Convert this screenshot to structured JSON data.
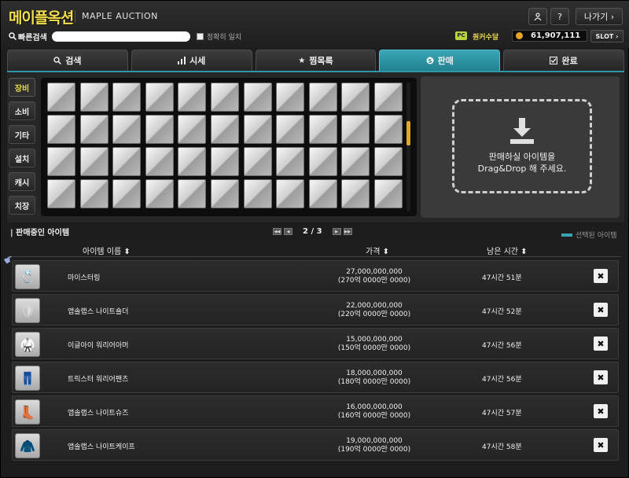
{
  "header": {
    "logo": "메이플옥션",
    "subtitle": "MAPLE AUCTION",
    "profile_icon": "person-icon",
    "help_label": "?",
    "exit_label": "나가기 ›"
  },
  "search": {
    "label": "빠른검색",
    "value": "",
    "exact_label": "정확히 일치"
  },
  "wallet": {
    "pc_badge": "PC",
    "currency_label": "퀀커수달",
    "meso": "61,907,111",
    "slot_label": "SLOT ›"
  },
  "tabs": [
    {
      "label": "검색",
      "icon": "search-icon"
    },
    {
      "label": "시세",
      "icon": "bar-chart-icon"
    },
    {
      "label": "찜목록",
      "icon": "star-icon"
    },
    {
      "label": "판매",
      "icon": "coin-icon"
    },
    {
      "label": "완료",
      "icon": "check-box-icon"
    }
  ],
  "categories": [
    "장비",
    "소비",
    "기타",
    "설치",
    "캐시",
    "치장"
  ],
  "dropzone": {
    "line1": "판매하실 아이템을",
    "line2": "Drag&Drop 해 주세요."
  },
  "selling": {
    "title": "판매중인 아이템",
    "page": "2 / 3",
    "legend": "선택된 아이템",
    "columns": {
      "name": "아이템 이름 ⬍",
      "price": "가격 ⬍",
      "time": "남은 시간 ⬍"
    }
  },
  "items": [
    {
      "name": "마이스터링",
      "price": "27,000,000,000",
      "price_kr": "(270억 0000만 0000)",
      "time": "47시간 51분",
      "icon": "ring-icon"
    },
    {
      "name": "앱솔랩스 나이트숄더",
      "price": "22,000,000,000",
      "price_kr": "(220억 0000만 0000)",
      "time": "47시간 52분",
      "icon": "shoulder-icon"
    },
    {
      "name": "이글아이 워리어아머",
      "price": "15,000,000,000",
      "price_kr": "(150억 0000만 0000)",
      "time": "47시간 56분",
      "icon": "armor-icon"
    },
    {
      "name": "트릭스터 워리어팬츠",
      "price": "18,000,000,000",
      "price_kr": "(180억 0000만 0000)",
      "time": "47시간 56분",
      "icon": "pants-icon"
    },
    {
      "name": "앱솔랩스 나이트슈즈",
      "price": "16,000,000,000",
      "price_kr": "(160억 0000만 0000)",
      "time": "47시간 57분",
      "icon": "shoes-icon"
    },
    {
      "name": "앱솔랩스 나이트케이프",
      "price": "19,000,000,000",
      "price_kr": "(190억 0000만 0000)",
      "time": "47시간 58분",
      "icon": "cape-icon"
    }
  ],
  "colors": {
    "accent": "#2f97a7",
    "logo": "#f4e04a",
    "scroll": "#e0a92c"
  }
}
